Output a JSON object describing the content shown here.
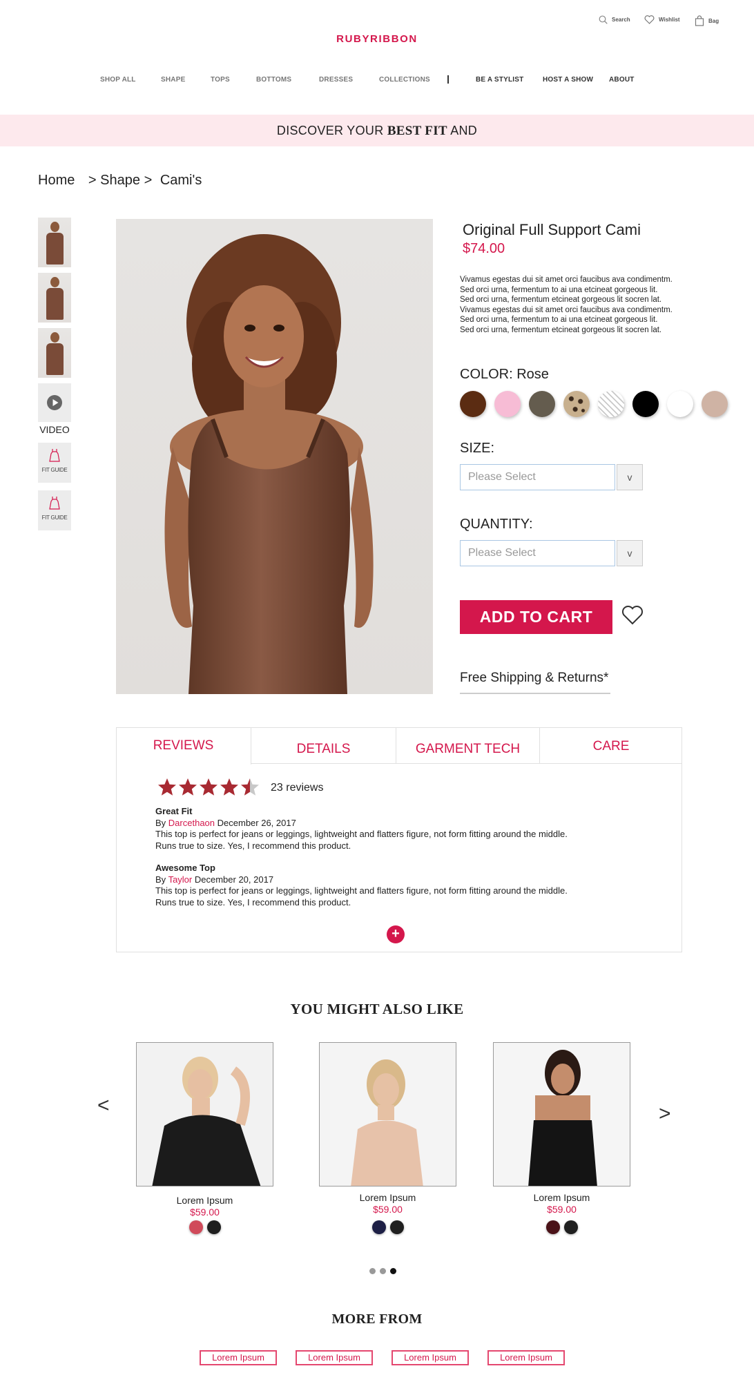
{
  "header": {
    "logo": "RUBYRIBBON",
    "search_label": "Search",
    "wishlist_label": "Wishlist",
    "bag_label": "Bag",
    "nav": [
      "SHOP ALL",
      "SHAPE",
      "TOPS",
      "BOTTOMS",
      "DRESSES",
      "COLLECTIONS",
      "BE A STYLIST",
      "HOST A SHOW",
      "ABOUT"
    ]
  },
  "banner": {
    "text_start": "DISCOVER YOUR",
    "text_bold": "BEST FIT",
    "text_end": "AND"
  },
  "breadcrumb": [
    "Home",
    "Shape",
    "Cami's"
  ],
  "gallery": {
    "video_label": "VIDEO",
    "fit_guide_label": "FIT GUIDE"
  },
  "product": {
    "title": "Original Full Support Cami",
    "price": "$74.00",
    "description": [
      "Vivamus egestas dui sit amet orci faucibus ava condimentm.",
      "Sed orci urna, fermentum to ai una etcineat gorgeous lit.",
      "Sed orci urna, fermentum  etcineat gorgeous lit socren lat.",
      "Vivamus egestas dui sit amet orci faucibus ava condimentm.",
      "Sed orci urna, fermentum to ai una etcineat gorgeous lit.",
      "Sed orci urna, fermentum  etcineat gorgeous lit socren lat."
    ],
    "color_label": "COLOR: Rose",
    "swatches": [
      "#5b2c12",
      "#f7bcd5",
      "#645c4e",
      "leopard",
      "pattern-white",
      "#000000",
      "#ffffff",
      "#cfb3a4"
    ],
    "size_label": "SIZE:",
    "size_placeholder": "Please Select",
    "quantity_label": "QUANTITY:",
    "quantity_placeholder": "Please Select",
    "select_arrow": "v",
    "add_to_cart": "ADD TO CART",
    "shipping": "Free Shipping & Returns*"
  },
  "tabs": [
    "REVIEWS",
    "DETAILS",
    "GARMENT TECH",
    "CARE"
  ],
  "reviews": {
    "rating": 4.5,
    "count_label": "23 reviews",
    "items": [
      {
        "title": "Great Fit",
        "by": "By",
        "author": "Darcethaon",
        "date": "December 26, 2017",
        "line1": "This top is perfect for jeans or leggings, lightweight and flatters figure, not form fitting around the middle.",
        "line2": "Runs true to size. Yes, I recommend this product."
      },
      {
        "title": "Awesome Top",
        "by": "By",
        "author": "Taylor",
        "date": "December 20, 2017",
        "line1": "This top is perfect for jeans or leggings, lightweight and flatters figure, not form fitting around the middle.",
        "line2": "Runs true to size. Yes, I recommend this product."
      }
    ],
    "more": "+"
  },
  "recommendations": {
    "title": "YOU MIGHT ALSO LIKE",
    "prev": "<",
    "next": ">",
    "items": [
      {
        "name": "Lorem Ipsum",
        "price": "$59.00",
        "colors": [
          "#d04a5a",
          "#1f1f1f"
        ]
      },
      {
        "name": "Lorem Ipsum",
        "price": "$59.00",
        "colors": [
          "#1d1f45",
          "#1f1f1f"
        ]
      },
      {
        "name": "Lorem Ipsum",
        "price": "$59.00",
        "colors": [
          "#4a1218",
          "#1f1f1f"
        ]
      }
    ],
    "active_page": 3,
    "page_count": 3
  },
  "more_from": {
    "title": "MORE FROM",
    "links": [
      "Lorem Ipsum",
      "Lorem Ipsum",
      "Lorem Ipsum",
      "Lorem Ipsum"
    ]
  }
}
